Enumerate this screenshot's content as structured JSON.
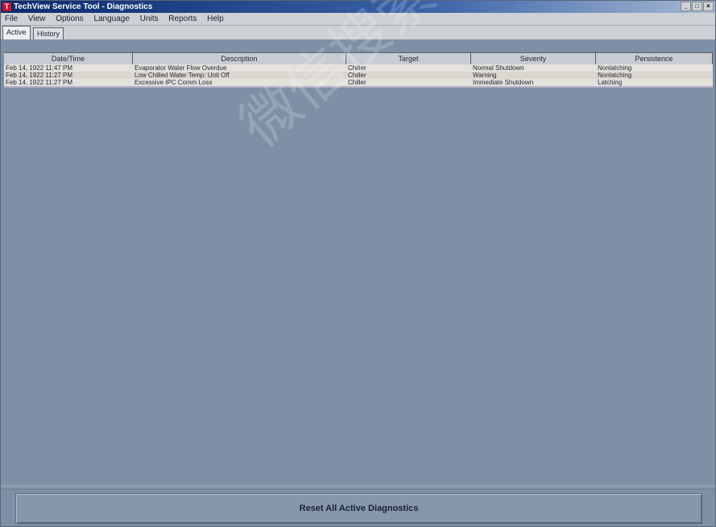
{
  "window": {
    "title": "TechView Service Tool - Diagnostics"
  },
  "menu": {
    "items": [
      "File",
      "View",
      "Options",
      "Language",
      "Units",
      "Reports",
      "Help"
    ]
  },
  "tabs": [
    {
      "label": "Active",
      "selected": true
    },
    {
      "label": "History",
      "selected": false
    }
  ],
  "table": {
    "columns": [
      "Date/Time",
      "Description",
      "Target",
      "Severity",
      "Persistence"
    ],
    "rows": [
      {
        "datetime": "Feb 14, 1922 11:47 PM",
        "description": "Evaporator Water Flow Overdue",
        "target": "Chiller",
        "severity": "Normal Shutdown",
        "persistence": "Nonlatching"
      },
      {
        "datetime": "Feb 14, 1922 11:27 PM",
        "description": "Low Chilled Water Temp: Unit Off",
        "target": "Chiller",
        "severity": "Warning",
        "persistence": "Nonlatching"
      },
      {
        "datetime": "Feb 14, 1922 11:27 PM",
        "description": "Excessive IPC Comm Loss",
        "target": "Chiller",
        "severity": "Immediate Shutdown",
        "persistence": "Latching"
      }
    ]
  },
  "footer": {
    "reset_label": "Reset All Active Diagnostics"
  },
  "watermark": {
    "text": "微信搜索蓝领"
  }
}
